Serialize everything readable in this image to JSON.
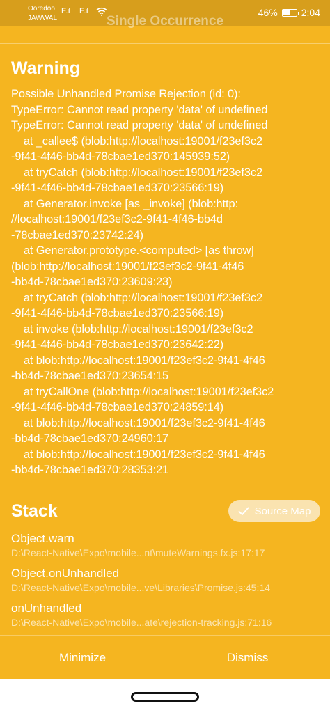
{
  "status_bar": {
    "carrier_line1": "Ooredoo",
    "carrier_line2": "JAWWAL",
    "signal1": "E.ıl",
    "signal2": "E.ıl",
    "battery_percent": "46%",
    "time": "2:04"
  },
  "header": {
    "title": "Single Occurrence"
  },
  "warning": {
    "title": "Warning",
    "message": "Possible Unhandled Promise Rejection (id: 0):\nTypeError: Cannot read property 'data' of undefined\nTypeError: Cannot read property 'data' of undefined\n    at _callee$ (blob:http://localhost:19001/f23ef3c2\n-9f41-4f46-bb4d-78cbae1ed370:145939:52)\n    at tryCatch (blob:http://localhost:19001/f23ef3c2\n-9f41-4f46-bb4d-78cbae1ed370:23566:19)\n    at Generator.invoke [as _invoke] (blob:http:\n//localhost:19001/f23ef3c2-9f41-4f46-bb4d\n-78cbae1ed370:23742:24)\n    at Generator.prototype.<computed> [as throw]\n(blob:http://localhost:19001/f23ef3c2-9f41-4f46\n-bb4d-78cbae1ed370:23609:23)\n    at tryCatch (blob:http://localhost:19001/f23ef3c2\n-9f41-4f46-bb4d-78cbae1ed370:23566:19)\n    at invoke (blob:http://localhost:19001/f23ef3c2\n-9f41-4f46-bb4d-78cbae1ed370:23642:22)\n    at blob:http://localhost:19001/f23ef3c2-9f41-4f46\n-bb4d-78cbae1ed370:23654:15\n    at tryCallOne (blob:http://localhost:19001/f23ef3c2\n-9f41-4f46-bb4d-78cbae1ed370:24859:14)\n    at blob:http://localhost:19001/f23ef3c2-9f41-4f46\n-bb4d-78cbae1ed370:24960:17\n    at blob:http://localhost:19001/f23ef3c2-9f41-4f46\n-bb4d-78cbae1ed370:28353:21"
  },
  "stack": {
    "title": "Stack",
    "source_map_label": "Source Map",
    "frames": [
      {
        "name": "Object.warn",
        "location": "D:\\React-Native\\Expo\\mobile...nt\\muteWarnings.fx.js:17:17"
      },
      {
        "name": "Object.onUnhandled",
        "location": "D:\\React-Native\\Expo\\mobile...ve\\Libraries\\Promise.js:45:14"
      },
      {
        "name": "onUnhandled",
        "location": "D:\\React-Native\\Expo\\mobile...ate\\rejection-tracking.js:71:16"
      }
    ]
  },
  "footer": {
    "minimize_label": "Minimize",
    "dismiss_label": "Dismiss"
  },
  "colors": {
    "background": "#F5B520",
    "status_bar": "#D79E1C",
    "text": "#FFFFFF"
  },
  "icons": [
    "wifi-icon",
    "signal-icon",
    "battery-icon",
    "check-icon",
    "home-pill-icon"
  ]
}
